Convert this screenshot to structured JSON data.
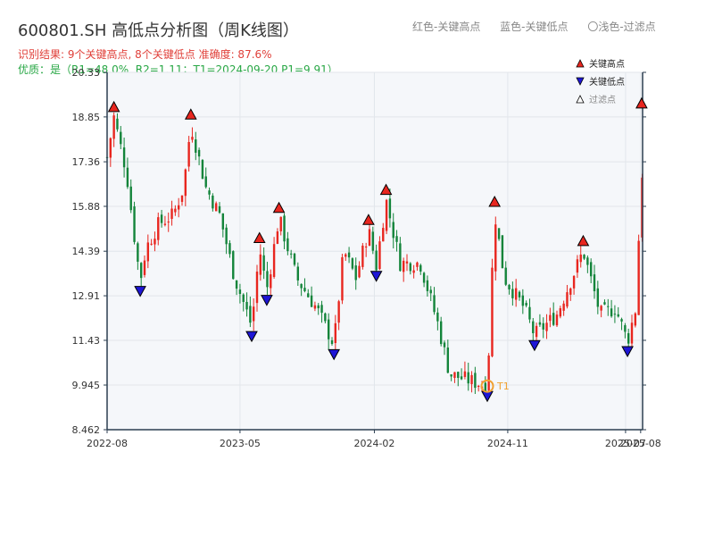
{
  "header": {
    "title": "600801.SH 高低点分析图（周K线图）",
    "result_line": "识别结果: 9个关键高点, 8个关键低点   准确度: 87.6%",
    "quality_line": "优质：是（R1=48.0%, R2=1.11；T1=2024-09-20 P1=9.91）",
    "legend_top": [
      "红色-关键高点",
      "蓝色-关键低点",
      "〇浅色-过滤点"
    ]
  },
  "legend": [
    {
      "label": "关键高点",
      "color": "#e8261f",
      "shape": "triangle-up"
    },
    {
      "label": "关键低点",
      "color": "#1e16d6",
      "shape": "triangle-down"
    },
    {
      "label": "过滤点",
      "color": "#ffffff",
      "shape": "triangle-up"
    }
  ],
  "colors": {
    "up": "#e8261f",
    "down": "#13843a",
    "high": "#e8261f",
    "low": "#1e16d6",
    "t1": "#f0a030",
    "axis": "#2c3e50"
  },
  "chart_data": {
    "type": "candlestick",
    "y_ticks": [
      "8.462",
      "9.945",
      "11.43",
      "12.91",
      "14.39",
      "15.88",
      "17.36",
      "18.85",
      "20.33"
    ],
    "ylim": [
      8.462,
      20.33
    ],
    "x_ticks": [
      "2022-08",
      "2023-05",
      "2024-02",
      "2024-11",
      "2025-07",
      "2025-08"
    ],
    "x_tick_dates": [
      "2022-08-01",
      "2023-05-01",
      "2024-02-01",
      "2024-11-01",
      "2025-07-01",
      "2025-08-01"
    ],
    "xlim": [
      "2022-08-01",
      "2025-08-05"
    ],
    "close_path": [
      [
        "2022-08-01",
        17.5
      ],
      [
        "2022-08-15",
        18.85
      ],
      [
        "2022-09-10",
        17.0
      ],
      [
        "2022-09-25",
        15.0
      ],
      [
        "2022-10-08",
        13.4
      ],
      [
        "2022-10-20",
        14.5
      ],
      [
        "2022-11-15",
        15.3
      ],
      [
        "2022-12-15",
        15.6
      ],
      [
        "2023-01-05",
        16.5
      ],
      [
        "2023-01-20",
        18.6
      ],
      [
        "2023-02-20",
        16.5
      ],
      [
        "2023-03-20",
        15.6
      ],
      [
        "2023-04-20",
        13.5
      ],
      [
        "2023-05-10",
        12.6
      ],
      [
        "2023-05-25",
        11.9
      ],
      [
        "2023-06-10",
        14.5
      ],
      [
        "2023-06-25",
        13.1
      ],
      [
        "2023-07-20",
        15.5
      ],
      [
        "2023-08-25",
        13.5
      ],
      [
        "2023-10-05",
        12.5
      ],
      [
        "2023-11-10",
        11.3
      ],
      [
        "2023-11-30",
        14.4
      ],
      [
        "2023-12-25",
        13.5
      ],
      [
        "2024-01-20",
        15.1
      ],
      [
        "2024-02-05",
        13.9
      ],
      [
        "2024-02-25",
        16.1
      ],
      [
        "2024-03-25",
        14.0
      ],
      [
        "2024-05-05",
        14.0
      ],
      [
        "2024-06-10",
        12.0
      ],
      [
        "2024-07-05",
        10.3
      ],
      [
        "2024-09-20",
        9.91
      ],
      [
        "2024-10-05",
        15.7
      ],
      [
        "2024-10-25",
        13.5
      ],
      [
        "2024-12-05",
        12.5
      ],
      [
        "2024-12-26",
        11.6
      ],
      [
        "2025-02-10",
        12.3
      ],
      [
        "2025-04-05",
        14.4
      ],
      [
        "2025-05-10",
        12.3
      ],
      [
        "2025-06-10",
        12.5
      ],
      [
        "2025-07-05",
        11.4
      ],
      [
        "2025-07-25",
        12.7
      ],
      [
        "2025-08-03",
        18.97
      ],
      [
        "2025-08-05",
        15.0
      ]
    ],
    "key_highs": [
      {
        "date": "2022-08-15",
        "price": 18.85
      },
      {
        "date": "2023-01-20",
        "price": 18.6
      },
      {
        "date": "2023-06-10",
        "price": 14.5
      },
      {
        "date": "2023-07-20",
        "price": 15.5
      },
      {
        "date": "2024-01-20",
        "price": 15.1
      },
      {
        "date": "2024-02-25",
        "price": 16.1
      },
      {
        "date": "2024-10-05",
        "price": 15.7
      },
      {
        "date": "2025-04-05",
        "price": 14.4
      },
      {
        "date": "2025-08-03",
        "price": 18.97
      }
    ],
    "key_lows": [
      {
        "date": "2022-10-08",
        "price": 13.4
      },
      {
        "date": "2023-05-25",
        "price": 11.9
      },
      {
        "date": "2023-06-25",
        "price": 13.1
      },
      {
        "date": "2023-11-10",
        "price": 11.3
      },
      {
        "date": "2024-02-05",
        "price": 13.9
      },
      {
        "date": "2024-09-20",
        "price": 9.91
      },
      {
        "date": "2024-12-26",
        "price": 11.6
      },
      {
        "date": "2025-07-05",
        "price": 11.4
      }
    ],
    "t1": {
      "label": "T1",
      "date": "2024-09-20",
      "price": 9.91
    }
  }
}
